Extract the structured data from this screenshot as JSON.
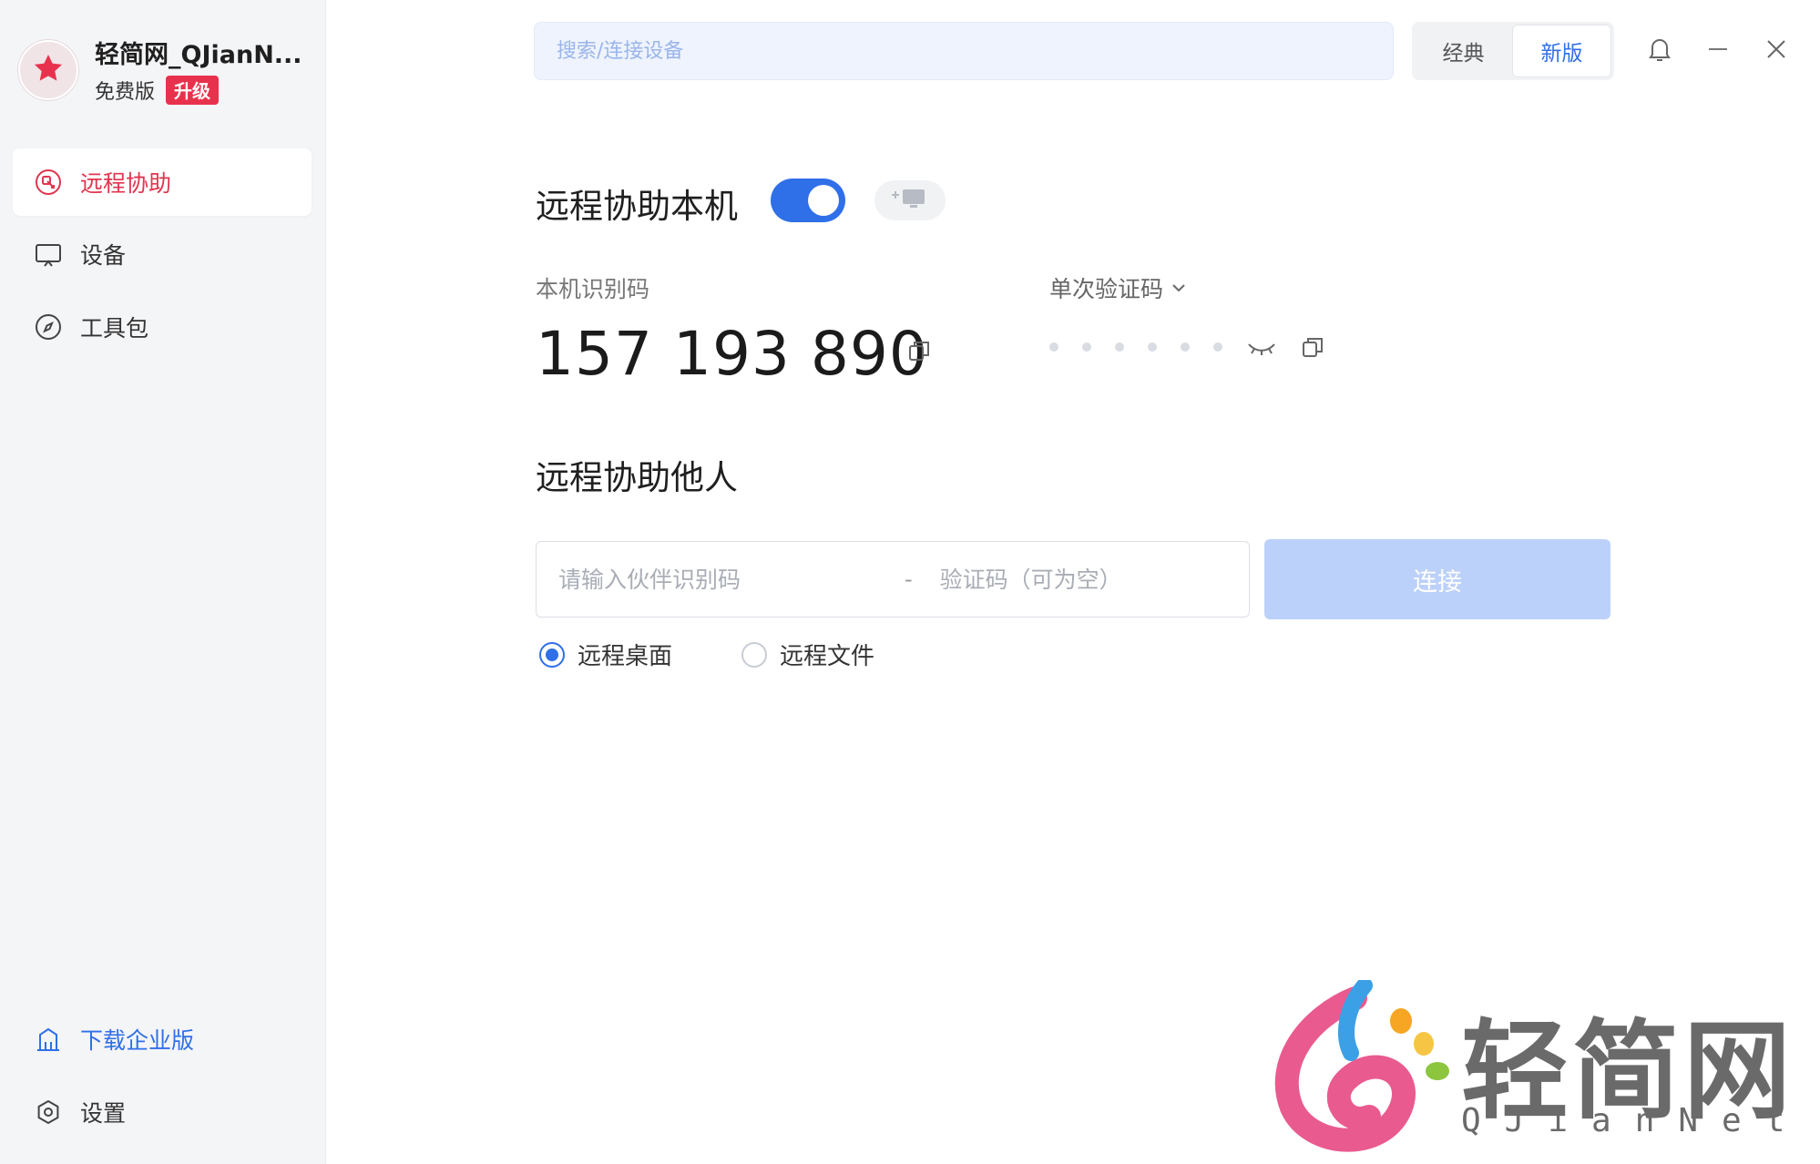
{
  "profile": {
    "username": "轻简网_QJianN...",
    "plan": "免费版",
    "upgrade_label": "升级",
    "avatar_icon": "star-icon",
    "accent_color": "#e8324d"
  },
  "sidebar": {
    "items": [
      {
        "label": "远程协助",
        "icon": "remote-assist-icon",
        "active": true
      },
      {
        "label": "设备",
        "icon": "monitor-icon",
        "active": false
      },
      {
        "label": "工具包",
        "icon": "compass-icon",
        "active": false
      }
    ],
    "bottom": [
      {
        "label": "下载企业版",
        "icon": "building-icon"
      },
      {
        "label": "设置",
        "icon": "gear-icon"
      }
    ]
  },
  "header": {
    "search_placeholder": "搜索/连接设备",
    "modes": [
      {
        "label": "经典",
        "active": false
      },
      {
        "label": "新版",
        "active": true
      }
    ]
  },
  "assist_self": {
    "title": "远程协助本机",
    "toggle_on": true,
    "device_id_label": "本机识别码",
    "device_id": "157 193 890",
    "code_mode_label": "单次验证码",
    "code_masked_count": 6
  },
  "assist_others": {
    "title": "远程协助他人",
    "partner_placeholder": "请输入伙伴识别码",
    "separator": "-",
    "code_placeholder": "验证码（可为空）",
    "connect_label": "连接",
    "options": [
      {
        "label": "远程桌面",
        "checked": true
      },
      {
        "label": "远程文件",
        "checked": false
      }
    ]
  },
  "watermark": {
    "title": "轻简网",
    "subtitle": "QJianNet"
  },
  "colors": {
    "primary": "#2f6fe8",
    "active_nav": "#e0354f",
    "connect_disabled": "#bcd1fa"
  }
}
